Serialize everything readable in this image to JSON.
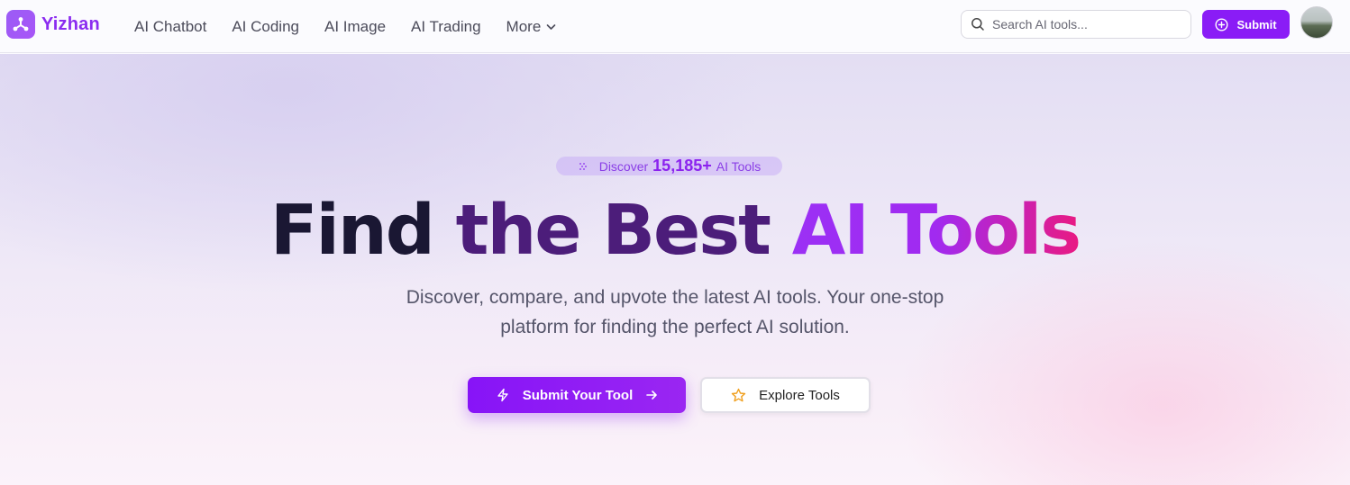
{
  "brand": {
    "name": "Yizhan",
    "logo_icon": "share-nodes-icon"
  },
  "nav": {
    "links": [
      "AI Chatbot",
      "AI Coding",
      "AI Image",
      "AI Trading"
    ],
    "more_label": "More"
  },
  "search": {
    "placeholder": "Search AI tools...",
    "value": ""
  },
  "header_actions": {
    "submit_label": "Submit",
    "submit_icon": "plus-circle-icon"
  },
  "hero": {
    "badge": {
      "prefix": "Discover",
      "count": "15,185+",
      "suffix": "AI Tools"
    },
    "headline": {
      "part1": "Find",
      "part2": "the Best",
      "part3": "AI Tools"
    },
    "subtitle": "Discover, compare, and upvote the latest AI tools. Your one-stop platform for finding the perfect AI solution.",
    "primary_cta": "Submit Your Tool",
    "secondary_cta": "Explore Tools"
  },
  "colors": {
    "accent": "#8a1cf6",
    "brand_text": "#8b2cf0",
    "headline_dark": "#1a1733",
    "headline_purple": "#4c1d7a",
    "gradient_end": "#e91a82",
    "star": "#f0a020"
  }
}
